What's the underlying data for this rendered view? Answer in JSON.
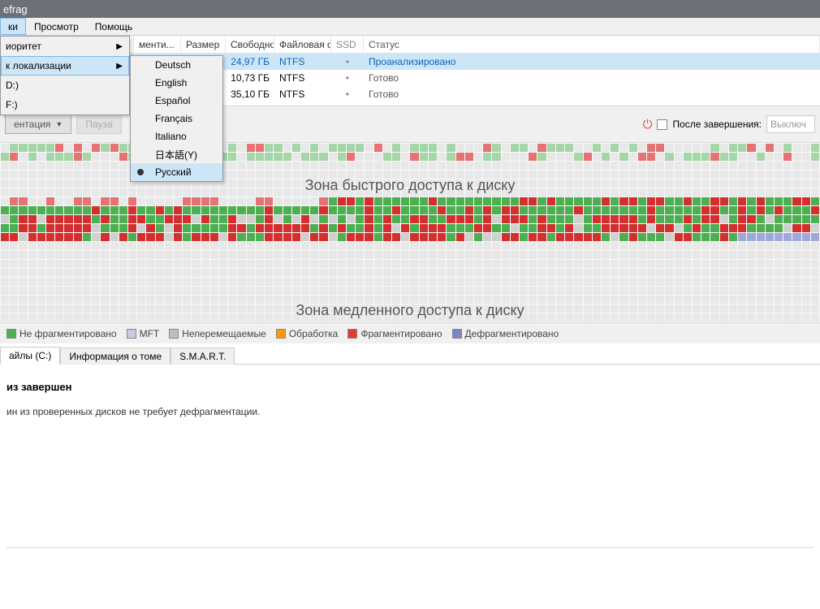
{
  "title": "efrag",
  "menubar": {
    "settings": "ки",
    "view": "Просмотр",
    "help": "Помощь"
  },
  "submenu1": {
    "priority": "иоритет",
    "localization": "к локализации"
  },
  "drives_extra": {
    "d": "D:)",
    "f": "F:)"
  },
  "languages": {
    "de": "Deutsch",
    "en": "English",
    "es": "Español",
    "fr": "Français",
    "it": "Italiano",
    "ja": "日本語(Y)",
    "ru": "Русский"
  },
  "table": {
    "headers": {
      "name": "",
      "frag": "менти...",
      "size": "Размер",
      "free": "Свободно",
      "fs": "Файловая с...",
      "ssd": "SSD",
      "status": "Статус"
    },
    "rows": [
      {
        "name": "",
        "frag": "",
        "size": "",
        "free": "24,97 ГБ",
        "fs": "NTFS",
        "ssd": "•",
        "status": "Проанализировано",
        "sel": true
      },
      {
        "name": "",
        "frag": "",
        "size": "",
        "free": "10,73 ГБ",
        "fs": "NTFS",
        "ssd": "•",
        "status": "Готово",
        "sel": false
      },
      {
        "name": "",
        "frag": "",
        "size": "",
        "free": "35,10 ГБ",
        "fs": "NTFS",
        "ssd": "•",
        "status": "Готово",
        "sel": false
      }
    ]
  },
  "toolbar": {
    "defrag": "ентация",
    "pause": "Пауза",
    "after_label": "После завершения:",
    "after_value": "Выключ"
  },
  "zones": {
    "fast": "Зона быстрого доступа к диску",
    "slow": "Зона медленного доступа к диску"
  },
  "legend": {
    "notfrag": "Не фрагментировано",
    "mft": "MFT",
    "unmov": "Неперемещаемые",
    "proc": "Обработка",
    "frag": "Фрагментировано",
    "defrag": "Дефрагментировано"
  },
  "tabs": {
    "files": "айлы (C:)",
    "volinfo": "Информация о томе",
    "smart": "S.M.A.R.T."
  },
  "result": {
    "heading": "из завершен",
    "text": "ин из проверенных дисков не требует дефрагментации."
  }
}
